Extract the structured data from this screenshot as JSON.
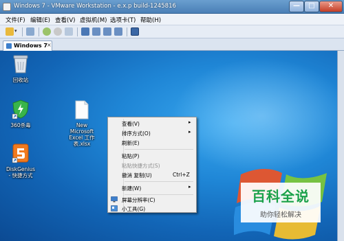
{
  "window": {
    "title": "Windows 7 - VMware Workstation - e.x.p build-1245816",
    "controls": {
      "minimize": "—",
      "maximize": "□",
      "close": "✕"
    }
  },
  "menubar": [
    {
      "label": "文件(F)"
    },
    {
      "label": "编辑(E)"
    },
    {
      "label": "查看(V)"
    },
    {
      "label": "虚拟机(M)"
    },
    {
      "label": "选项卡(T)"
    },
    {
      "label": "帮助(H)"
    }
  ],
  "tab": {
    "label": "Windows 7",
    "close": "×"
  },
  "desktop": {
    "icons": [
      {
        "label": "回收站",
        "icon": "recycle-bin-icon"
      },
      {
        "label": "360杀毒",
        "icon": "360-antivirus-icon"
      },
      {
        "label": "DiskGenius\n- 快捷方式",
        "icon": "diskgenius-icon"
      },
      {
        "label": "New\nMicrosoft\nExcel 工作\n表.xlsx",
        "icon": "excel-file-icon"
      }
    ]
  },
  "context_menu": {
    "items": [
      {
        "label": "查看(V)",
        "submenu": true
      },
      {
        "label": "排序方式(O)",
        "submenu": true
      },
      {
        "label": "刷新(E)"
      },
      {
        "label": "粘贴(P)"
      },
      {
        "label": "粘贴快捷方式(S)",
        "disabled": true
      },
      {
        "label": "撤消 复制(U)",
        "shortcut": "Ctrl+Z"
      },
      {
        "label": "新建(W)",
        "submenu": true
      },
      {
        "label": "屏幕分辨率(C)",
        "icon": "screen-resolution-icon"
      },
      {
        "label": "小工具(G)",
        "icon": "gadgets-icon"
      }
    ],
    "arrow": "▸"
  },
  "watermark": {
    "title": "百科全说",
    "subtitle": "助你轻松解决"
  },
  "colors": {
    "desktop": "#1f86d6",
    "titlebar": "#4a7fb6",
    "watermark_green": "#1aa14a"
  }
}
